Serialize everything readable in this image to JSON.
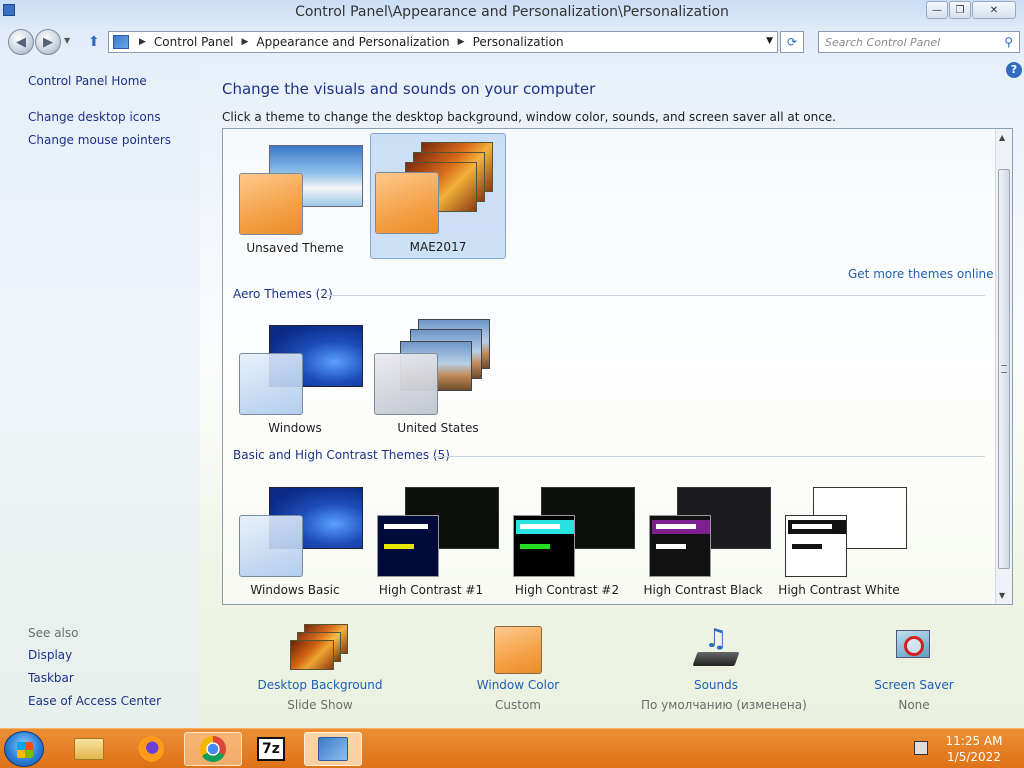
{
  "window": {
    "title": "Control Panel\\Appearance and Personalization\\Personalization",
    "minimize_glyph": "—",
    "maximize_glyph": "❐",
    "close_glyph": "✕"
  },
  "nav": {
    "back_glyph": "◀",
    "forward_glyph": "▶",
    "breadcrumbs": [
      "Control Panel",
      "Appearance and Personalization",
      "Personalization"
    ],
    "search_placeholder": "Search Control Panel"
  },
  "left_pane": {
    "links": [
      "Control Panel Home",
      "Change desktop icons",
      "Change mouse pointers"
    ],
    "see_also_label": "See also",
    "see_also_links": [
      "Display",
      "Taskbar",
      "Ease of Access Center"
    ]
  },
  "content": {
    "heading": "Change the visuals and sounds on your computer",
    "subheading": "Click a theme to change the desktop background, window color, sounds, and screen saver all at once.",
    "my_themes": [
      "Unsaved Theme",
      "MAE2017"
    ],
    "selected_theme": "MAE2017",
    "get_more_link": "Get more themes online",
    "aero_group_label": "Aero Themes (2)",
    "aero_themes": [
      "Windows",
      "United States"
    ],
    "basic_group_label": "Basic and High Contrast Themes (5)",
    "basic_themes": [
      "Windows Basic",
      "High Contrast #1",
      "High Contrast #2",
      "High Contrast Black",
      "High Contrast White"
    ]
  },
  "settings": [
    {
      "label": "Desktop Background",
      "value": "Slide Show",
      "icon": "desktop-background-icon"
    },
    {
      "label": "Window Color",
      "value": "Custom",
      "icon": "window-color-icon"
    },
    {
      "label": "Sounds",
      "value": "По умолчанию (изменена)",
      "icon": "sounds-icon"
    },
    {
      "label": "Screen Saver",
      "value": "None",
      "icon": "screen-saver-icon"
    }
  ],
  "taskbar": {
    "apps": [
      "file-explorer",
      "firefox",
      "chrome",
      "7-zip",
      "control-panel"
    ],
    "sevenzip_label": "7z",
    "time": "11:25 AM",
    "date": "1/5/2022"
  },
  "colors": {
    "link": "#1e3287",
    "taskbar": "#e8781e",
    "selection": "#adcdf0"
  }
}
